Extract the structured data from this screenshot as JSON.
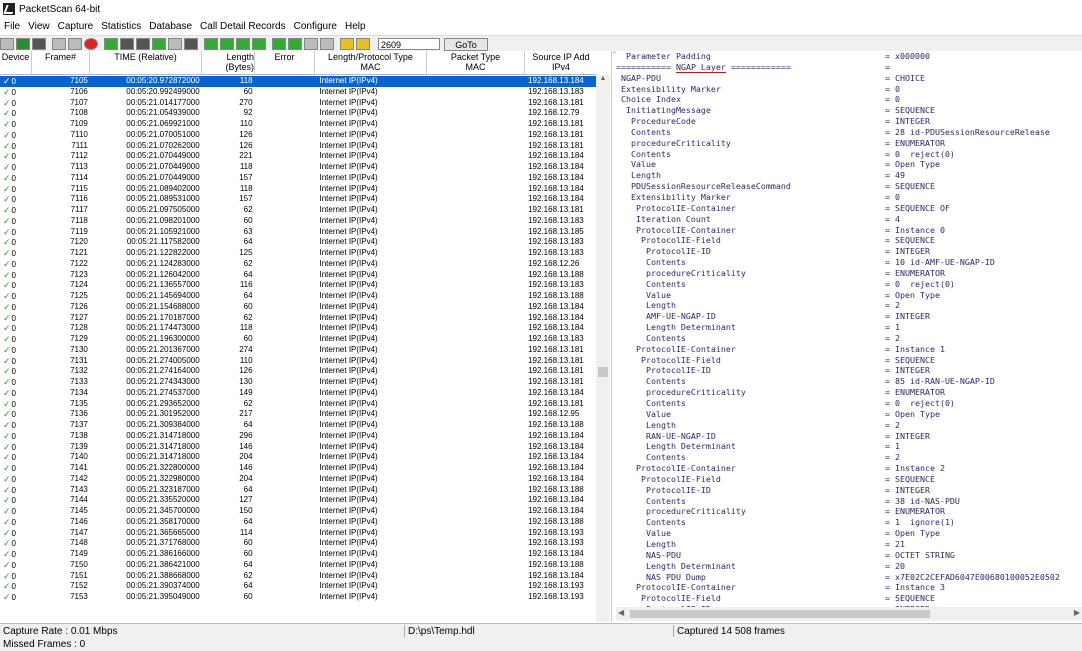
{
  "window": {
    "title": "PacketScan 64-bit"
  },
  "menu": [
    "File",
    "View",
    "Capture",
    "Statistics",
    "Database",
    "Call Detail Records",
    "Configure",
    "Help"
  ],
  "toolbar": {
    "frame_value": "2609",
    "goto_label": "GoTo"
  },
  "table": {
    "headers": {
      "device": "Device",
      "frame": "Frame#",
      "time": "TIME (Relative)",
      "length": "Length (Bytes)",
      "error": "Error",
      "protocol": "Length/Protocol Type\nMAC",
      "packet_type": "Packet Type\nMAC",
      "source_ip": "Source IP Add\nIPv4"
    },
    "rows": [
      [
        "0",
        "7105",
        "00:05:20.972872000",
        "118",
        "Internet IP(IPv4)",
        "192.168.13.184"
      ],
      [
        "0",
        "7106",
        "00:05:20.992499000",
        "60",
        "Internet IP(IPv4)",
        "192.168.13.183"
      ],
      [
        "0",
        "7107",
        "00:05:21.014177000",
        "270",
        "Internet IP(IPv4)",
        "192.168.13.181"
      ],
      [
        "0",
        "7108",
        "00:05:21.054939000",
        "92",
        "Internet IP(IPv4)",
        "192.168.12.79"
      ],
      [
        "0",
        "7109",
        "00:05:21.069921000",
        "110",
        "Internet IP(IPv4)",
        "192.168.13.181"
      ],
      [
        "0",
        "7110",
        "00:05:21.070051000",
        "126",
        "Internet IP(IPv4)",
        "192.168.13.181"
      ],
      [
        "0",
        "7111",
        "00:05:21.070262000",
        "126",
        "Internet IP(IPv4)",
        "192.168.13.181"
      ],
      [
        "0",
        "7112",
        "00:05:21.070449000",
        "221",
        "Internet IP(IPv4)",
        "192.168.13.184"
      ],
      [
        "0",
        "7113",
        "00:05:21.070449000",
        "118",
        "Internet IP(IPv4)",
        "192.168.13.184"
      ],
      [
        "0",
        "7114",
        "00:05:21.070449000",
        "157",
        "Internet IP(IPv4)",
        "192.168.13.184"
      ],
      [
        "0",
        "7115",
        "00:05:21.089402000",
        "118",
        "Internet IP(IPv4)",
        "192.168.13.184"
      ],
      [
        "0",
        "7116",
        "00:05:21.089531000",
        "157",
        "Internet IP(IPv4)",
        "192.168.13.184"
      ],
      [
        "0",
        "7117",
        "00:05:21.097505000",
        "62",
        "Internet IP(IPv4)",
        "192.168.13.181"
      ],
      [
        "0",
        "7118",
        "00:05:21.098201000",
        "60",
        "Internet IP(IPv4)",
        "192.168.13.183"
      ],
      [
        "0",
        "7119",
        "00:05:21.105921000",
        "63",
        "Internet IP(IPv4)",
        "192.168.13.185"
      ],
      [
        "0",
        "7120",
        "00:05:21.117582000",
        "64",
        "Internet IP(IPv4)",
        "192.168.13.183"
      ],
      [
        "0",
        "7121",
        "00:05:21.122822000",
        "125",
        "Internet IP(IPv4)",
        "192.168.13.183"
      ],
      [
        "0",
        "7122",
        "00:05:21.124283000",
        "62",
        "Internet IP(IPv4)",
        "192.168.12.26"
      ],
      [
        "0",
        "7123",
        "00:05:21.126042000",
        "64",
        "Internet IP(IPv4)",
        "192.168.13.188"
      ],
      [
        "0",
        "7124",
        "00:05:21.136557000",
        "116",
        "Internet IP(IPv4)",
        "192.168.13.183"
      ],
      [
        "0",
        "7125",
        "00:05:21.145694000",
        "64",
        "Internet IP(IPv4)",
        "192.168.13.188"
      ],
      [
        "0",
        "7126",
        "00:05:21.154688000",
        "60",
        "Internet IP(IPv4)",
        "192.168.13.184"
      ],
      [
        "0",
        "7127",
        "00:05:21.170187000",
        "62",
        "Internet IP(IPv4)",
        "192.168.13.184"
      ],
      [
        "0",
        "7128",
        "00:05:21.174473000",
        "118",
        "Internet IP(IPv4)",
        "192.168.13.184"
      ],
      [
        "0",
        "7129",
        "00:05:21.196300000",
        "60",
        "Internet IP(IPv4)",
        "192.168.13.183"
      ],
      [
        "0",
        "7130",
        "00:05:21.201367000",
        "274",
        "Internet IP(IPv4)",
        "192.168.13.181"
      ],
      [
        "0",
        "7131",
        "00:05:21.274005000",
        "110",
        "Internet IP(IPv4)",
        "192.168.13.181"
      ],
      [
        "0",
        "7132",
        "00:05:21.274164000",
        "126",
        "Internet IP(IPv4)",
        "192.168.13.181"
      ],
      [
        "0",
        "7133",
        "00:05:21.274343000",
        "130",
        "Internet IP(IPv4)",
        "192.168.13.181"
      ],
      [
        "0",
        "7134",
        "00:05:21.274537000",
        "149",
        "Internet IP(IPv4)",
        "192.168.13.184"
      ],
      [
        "0",
        "7135",
        "00:05:21.293652000",
        "62",
        "Internet IP(IPv4)",
        "192.168.13.181"
      ],
      [
        "0",
        "7136",
        "00:05:21.301952000",
        "217",
        "Internet IP(IPv4)",
        "192.168.12.95"
      ],
      [
        "0",
        "7137",
        "00:05:21.309384000",
        "64",
        "Internet IP(IPv4)",
        "192.168.13.188"
      ],
      [
        "0",
        "7138",
        "00:05:21.314718000",
        "296",
        "Internet IP(IPv4)",
        "192.168.13.184"
      ],
      [
        "0",
        "7139",
        "00:05:21.314718000",
        "146",
        "Internet IP(IPv4)",
        "192.168.13.184"
      ],
      [
        "0",
        "7140",
        "00:05:21.314718000",
        "204",
        "Internet IP(IPv4)",
        "192.168.13.184"
      ],
      [
        "0",
        "7141",
        "00:05:21.322800000",
        "146",
        "Internet IP(IPv4)",
        "192.168.13.184"
      ],
      [
        "0",
        "7142",
        "00:05:21.322980000",
        "204",
        "Internet IP(IPv4)",
        "192.168.13.184"
      ],
      [
        "0",
        "7143",
        "00:05:21.323187000",
        "64",
        "Internet IP(IPv4)",
        "192.168.13.188"
      ],
      [
        "0",
        "7144",
        "00:05:21.335520000",
        "127",
        "Internet IP(IPv4)",
        "192.168.13.184"
      ],
      [
        "0",
        "7145",
        "00:05:21.345700000",
        "150",
        "Internet IP(IPv4)",
        "192.168.13.184"
      ],
      [
        "0",
        "7146",
        "00:05:21.358170000",
        "64",
        "Internet IP(IPv4)",
        "192.168.13.188"
      ],
      [
        "0",
        "7147",
        "00:05:21.365665000",
        "114",
        "Internet IP(IPv4)",
        "192.168.13.193"
      ],
      [
        "0",
        "7148",
        "00:05:21.371768000",
        "60",
        "Internet IP(IPv4)",
        "192.168.13.193"
      ],
      [
        "0",
        "7149",
        "00:05:21.386166000",
        "60",
        "Internet IP(IPv4)",
        "192.168.13.184"
      ],
      [
        "0",
        "7150",
        "00:05:21.386421000",
        "64",
        "Internet IP(IPv4)",
        "192.168.13.188"
      ],
      [
        "0",
        "7151",
        "00:05:21.388668000",
        "62",
        "Internet IP(IPv4)",
        "192.168.13.184"
      ],
      [
        "0",
        "7152",
        "00:05:21.390374000",
        "64",
        "Internet IP(IPv4)",
        "192.168.13.193"
      ],
      [
        "0",
        "7153",
        "00:05:21.395049000",
        "60",
        "Internet IP(IPv4)",
        "192.168.13.193"
      ]
    ]
  },
  "detail": {
    "lines": [
      [
        "  Parameter Padding",
        "= x000000"
      ],
      [
        "=========== NGAP Layer ============",
        "="
      ],
      [
        " NGAP-PDU",
        "= CHOICE"
      ],
      [
        " Extensibility Marker",
        "= 0"
      ],
      [
        " Choice Index",
        "= 0"
      ],
      [
        "  InitiatingMessage",
        "= SEQUENCE"
      ],
      [
        "   ProcedureCode",
        "= INTEGER"
      ],
      [
        "   Contents",
        "= 28 id-PDUSessionResourceRelease"
      ],
      [
        "   procedureCriticality",
        "= ENUMERATOR"
      ],
      [
        "   Contents",
        "= 0  reject(0)"
      ],
      [
        "   Value",
        "= Open Type"
      ],
      [
        "   Length",
        "= 49"
      ],
      [
        "   PDUSessionResourceReleaseCommand",
        "= SEQUENCE"
      ],
      [
        "   Extensibility Marker",
        "= 0"
      ],
      [
        "    ProtocolIE-Container",
        "= SEQUENCE OF"
      ],
      [
        "    Iteration Count",
        "= 4"
      ],
      [
        "    ProtocolIE-Container",
        "= Instance 0"
      ],
      [
        "     ProtocolIE-Field",
        "= SEQUENCE"
      ],
      [
        "      ProtocolIE-ID",
        "= INTEGER"
      ],
      [
        "      Contents",
        "= 10 id-AMF-UE-NGAP-ID"
      ],
      [
        "      procedureCriticality",
        "= ENUMERATOR"
      ],
      [
        "      Contents",
        "= 0  reject(0)"
      ],
      [
        "      Value",
        "= Open Type"
      ],
      [
        "      Length",
        "= 2"
      ],
      [
        "      AMF-UE-NGAP-ID",
        "= INTEGER"
      ],
      [
        "      Length Determinant",
        "= 1"
      ],
      [
        "      Contents",
        "= 2"
      ],
      [
        "    ProtocolIE-Container",
        "= Instance 1"
      ],
      [
        "     ProtocolIE-Field",
        "= SEQUENCE"
      ],
      [
        "      ProtocolIE-ID",
        "= INTEGER"
      ],
      [
        "      Contents",
        "= 85 id-RAN-UE-NGAP-ID"
      ],
      [
        "      procedureCriticality",
        "= ENUMERATOR"
      ],
      [
        "      Contents",
        "= 0  reject(0)"
      ],
      [
        "      Value",
        "= Open Type"
      ],
      [
        "      Length",
        "= 2"
      ],
      [
        "      RAN-UE-NGAP-ID",
        "= INTEGER"
      ],
      [
        "      Length Determinant",
        "= 1"
      ],
      [
        "      Contents",
        "= 2"
      ],
      [
        "    ProtocolIE-Container",
        "= Instance 2"
      ],
      [
        "     ProtocolIE-Field",
        "= SEQUENCE"
      ],
      [
        "      ProtocolIE-ID",
        "= INTEGER"
      ],
      [
        "      Contents",
        "= 38 id-NAS-PDU"
      ],
      [
        "      procedureCriticality",
        "= ENUMERATOR"
      ],
      [
        "      Contents",
        "= 1  ignore(1)"
      ],
      [
        "      Value",
        "= Open Type"
      ],
      [
        "      Length",
        "= 21"
      ],
      [
        "      NAS-PDU",
        "= OCTET STRING"
      ],
      [
        "      Length Determinant",
        "= 20"
      ],
      [
        "      NAS PDU Dump",
        "= x7E02C2CEFAD6047E00680100052E0502"
      ],
      [
        "    ProtocolIE-Container",
        "= Instance 3"
      ],
      [
        "     ProtocolIE-Field",
        "= SEQUENCE"
      ],
      [
        "      ProtocolIE-ID",
        "= INTEGER"
      ]
    ]
  },
  "status": {
    "capture_rate": "Capture Rate : 0.01 Mbps",
    "file": "D:\\ps\\Temp.hdl",
    "captured": "Captured 14 508 frames",
    "missed": "Missed Frames : 0"
  },
  "colors": {
    "selection": "#0a63d3",
    "check": "#2a9d2a",
    "detail_text": "#2a2a6a",
    "underline": "#d01010"
  }
}
